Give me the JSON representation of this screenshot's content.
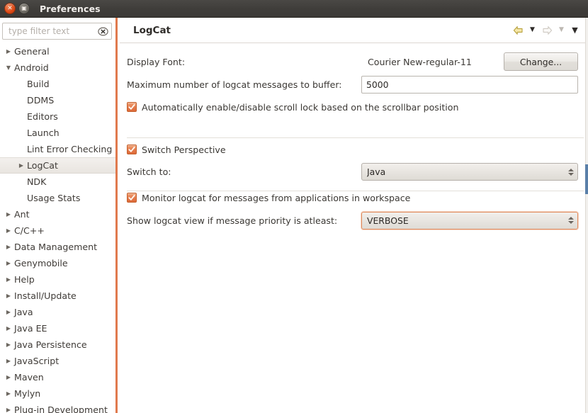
{
  "window": {
    "title": "Preferences",
    "close_icon": "window-close-icon",
    "maximize_icon": "window-maximize-icon",
    "close_glyph": "✕",
    "maximize_glyph": "▣"
  },
  "sidebar": {
    "filter": {
      "placeholder": "type filter text",
      "value": "",
      "clear_icon": "clear-filter-icon"
    },
    "items": [
      {
        "label": "General",
        "level": 1,
        "twisty": "collapsed",
        "selected": false
      },
      {
        "label": "Android",
        "level": 1,
        "twisty": "expanded",
        "selected": false
      },
      {
        "label": "Build",
        "level": 2,
        "twisty": "none",
        "selected": false
      },
      {
        "label": "DDMS",
        "level": 2,
        "twisty": "none",
        "selected": false
      },
      {
        "label": "Editors",
        "level": 2,
        "twisty": "none",
        "selected": false
      },
      {
        "label": "Launch",
        "level": 2,
        "twisty": "none",
        "selected": false
      },
      {
        "label": "Lint Error Checking",
        "level": 2,
        "twisty": "none",
        "selected": false
      },
      {
        "label": "LogCat",
        "level": 2,
        "twisty": "collapsed",
        "selected": true
      },
      {
        "label": "NDK",
        "level": 2,
        "twisty": "none",
        "selected": false
      },
      {
        "label": "Usage Stats",
        "level": 2,
        "twisty": "none",
        "selected": false
      },
      {
        "label": "Ant",
        "level": 1,
        "twisty": "collapsed",
        "selected": false
      },
      {
        "label": "C/C++",
        "level": 1,
        "twisty": "collapsed",
        "selected": false
      },
      {
        "label": "Data Management",
        "level": 1,
        "twisty": "collapsed",
        "selected": false
      },
      {
        "label": "Genymobile",
        "level": 1,
        "twisty": "collapsed",
        "selected": false
      },
      {
        "label": "Help",
        "level": 1,
        "twisty": "collapsed",
        "selected": false
      },
      {
        "label": "Install/Update",
        "level": 1,
        "twisty": "collapsed",
        "selected": false
      },
      {
        "label": "Java",
        "level": 1,
        "twisty": "collapsed",
        "selected": false
      },
      {
        "label": "Java EE",
        "level": 1,
        "twisty": "collapsed",
        "selected": false
      },
      {
        "label": "Java Persistence",
        "level": 1,
        "twisty": "collapsed",
        "selected": false
      },
      {
        "label": "JavaScript",
        "level": 1,
        "twisty": "collapsed",
        "selected": false
      },
      {
        "label": "Maven",
        "level": 1,
        "twisty": "collapsed",
        "selected": false
      },
      {
        "label": "Mylyn",
        "level": 1,
        "twisty": "collapsed",
        "selected": false
      },
      {
        "label": "Plug-in Development",
        "level": 1,
        "twisty": "collapsed",
        "selected": false
      }
    ]
  },
  "page": {
    "title": "LogCat",
    "nav": {
      "back_icon": "back-arrow-icon",
      "back_menu_icon": "chevron-down-icon",
      "forward_icon": "forward-arrow-icon",
      "forward_menu_icon": "chevron-down-icon",
      "menu_icon": "chevron-down-icon"
    },
    "display_font": {
      "label": "Display Font:",
      "value": "Courier New-regular-11",
      "button": "Change..."
    },
    "buffer": {
      "label": "Maximum number of logcat messages to buffer:",
      "value": "5000"
    },
    "scroll_lock": {
      "label": "Automatically enable/disable scroll lock based on the scrollbar position",
      "checked": true
    },
    "switch_perspective": {
      "label": "Switch Perspective",
      "checked": true
    },
    "switch_to": {
      "label": "Switch to:",
      "value": "Java",
      "options": [
        "Java"
      ]
    },
    "monitor_logcat": {
      "label": "Monitor logcat for messages from applications in workspace",
      "checked": true
    },
    "priority": {
      "label": "Show logcat view if message priority is atleast:",
      "value": "VERBOSE",
      "options": [
        "VERBOSE"
      ],
      "focused": true
    }
  },
  "colors": {
    "accent_orange": "#dd4814",
    "focus_border": "#e08a5c",
    "titlebar": "#3f3d3a",
    "tree_border": "#e07a4e"
  }
}
